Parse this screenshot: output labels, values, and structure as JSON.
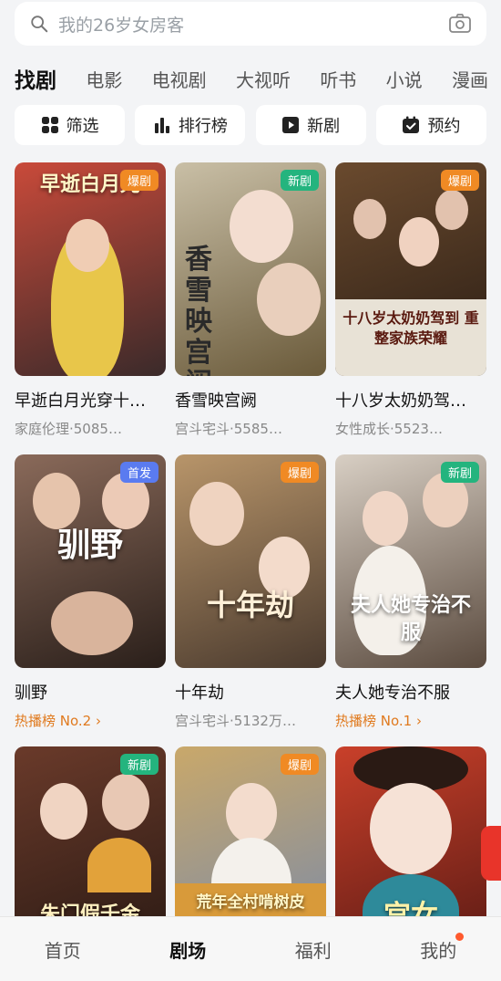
{
  "search": {
    "placeholder": "我的26岁女房客"
  },
  "tabs": [
    "找剧",
    "电影",
    "电视剧",
    "大视听",
    "听书",
    "小说",
    "漫画"
  ],
  "quick": [
    {
      "label": "筛选",
      "icon": "filter-grid-icon"
    },
    {
      "label": "排行榜",
      "icon": "ranking-bars-icon"
    },
    {
      "label": "新剧",
      "icon": "play-icon"
    },
    {
      "label": "预约",
      "icon": "calendar-check-icon"
    }
  ],
  "cards": [
    {
      "title": "早逝白月光穿十…",
      "meta": "家庭伦理·5085…",
      "badge": "爆剧",
      "poster_text": "早逝白月光",
      "color1": "#c94a3a",
      "color2": "#3a2a2a"
    },
    {
      "title": "香雪映宫阙",
      "meta": "宫斗宅斗·5585…",
      "badge": "新剧",
      "poster_text": "香雪映宫阙",
      "color1": "#c9bfa6",
      "color2": "#6a5a3a"
    },
    {
      "title": "十八岁太奶奶驾…",
      "meta": "女性成长·5523…",
      "badge": "爆剧",
      "poster_text": "十八岁太奶奶驾到 重整家族荣耀",
      "color1": "#6a4a2e",
      "color2": "#2a1d14"
    },
    {
      "title": "驯野",
      "meta": "热播榜 No.2 ›",
      "badge": "首发",
      "poster_text": "驯野",
      "color1": "#8a6a5a",
      "color2": "#2a1f1a"
    },
    {
      "title": "十年劫",
      "meta": "宫斗宅斗·5132万…",
      "badge": "爆剧",
      "poster_text": "十年劫",
      "color1": "#b8956a",
      "color2": "#4a3a2e"
    },
    {
      "title": "夫人她专治不服",
      "meta": "热播榜 No.1 ›",
      "badge": "新剧",
      "poster_text": "夫人她专治不服",
      "color1": "#d8cfc4",
      "color2": "#5a4a3e"
    },
    {
      "title": "",
      "meta": "",
      "badge": "新剧",
      "poster_text": "朱门假千金",
      "color1": "#6a3a2a",
      "color2": "#2a1a14"
    },
    {
      "title": "",
      "meta": "",
      "badge": "爆剧",
      "poster_text": "荒年全村啃树皮",
      "color1": "#c9a86a",
      "color2": "#7a8aa8"
    },
    {
      "title": "",
      "meta": "",
      "badge": "",
      "poster_text": "宫女",
      "color1": "#c9402a",
      "color2": "#5a1a14"
    }
  ],
  "nav": [
    "首页",
    "剧场",
    "福利",
    "我的"
  ]
}
